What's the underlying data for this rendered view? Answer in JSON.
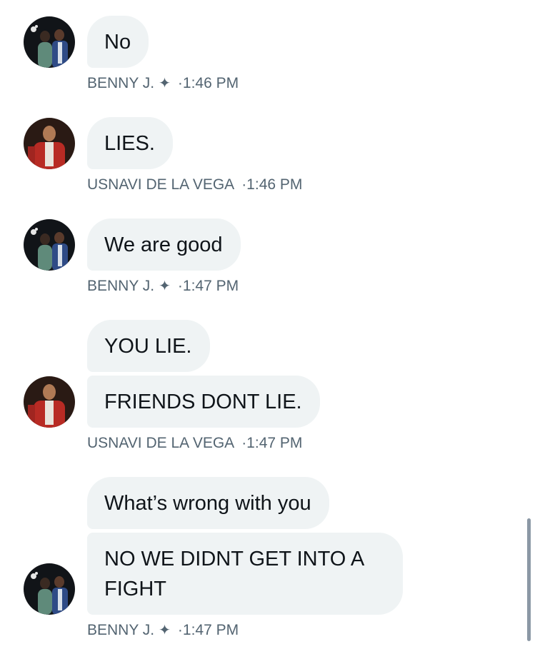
{
  "messages": [
    {
      "author": "BENNY J.",
      "badge": "✦",
      "time": "·1:46 PM",
      "bubbles": [
        "No"
      ]
    },
    {
      "author": "USNAVI DE LA VEGA",
      "badge": "",
      "time": "·1:46 PM",
      "bubbles": [
        "LIES."
      ]
    },
    {
      "author": "BENNY J.",
      "badge": "✦",
      "time": "·1:47 PM",
      "bubbles": [
        "We are good"
      ]
    },
    {
      "author": "USNAVI DE LA VEGA",
      "badge": "",
      "time": "·1:47 PM",
      "bubbles": [
        "YOU LIE.",
        "FRIENDS DONT LIE."
      ]
    },
    {
      "author": "BENNY J.",
      "badge": "✦",
      "time": "·1:47 PM",
      "bubbles": [
        "What’s wrong with you",
        "NO WE DIDNT GET INTO A FIGHT"
      ]
    }
  ],
  "avatars": {
    "benny": "avatar-benny",
    "usnavi": "avatar-usnavi"
  },
  "colors": {
    "bubble_bg": "#eff3f4",
    "text": "#0f1419",
    "meta": "#536471"
  }
}
